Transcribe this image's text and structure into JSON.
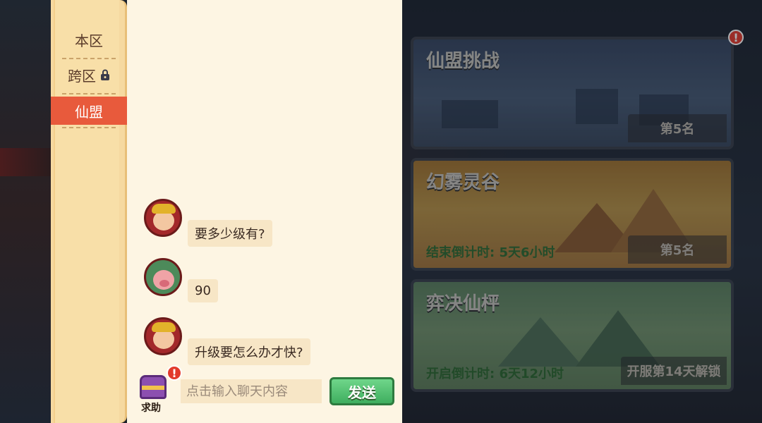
{
  "sidebar": {
    "tabs": [
      {
        "label": "本区",
        "locked": false,
        "active": false
      },
      {
        "label": "跨区",
        "locked": true,
        "active": false
      },
      {
        "label": "仙盟",
        "locked": false,
        "active": true
      }
    ]
  },
  "chat": {
    "messages": [
      {
        "avatar": "warrior-avatar",
        "text": "要多少级有?"
      },
      {
        "avatar": "pig-avatar",
        "text": "90"
      },
      {
        "avatar": "warrior-avatar",
        "text": "升级要怎么办才快?"
      }
    ],
    "input_placeholder": "点击输入聊天内容",
    "send_label": "发送",
    "help_label": "求助",
    "help_badge": "!"
  },
  "cards": [
    {
      "title": "仙盟挑战",
      "rank": "第5名",
      "timer": "",
      "badge": "!"
    },
    {
      "title": "幻雾灵谷",
      "rank": "第5名",
      "timer": "结束倒计时: 5天6小时"
    },
    {
      "title": "弈决仙枰",
      "rank": "开服第14天解锁",
      "timer": "开启倒计时: 6天12小时"
    }
  ],
  "colors": {
    "active_tab": "#e85a3c",
    "send_button": "#3fae5f",
    "badge": "#e23a2b"
  }
}
